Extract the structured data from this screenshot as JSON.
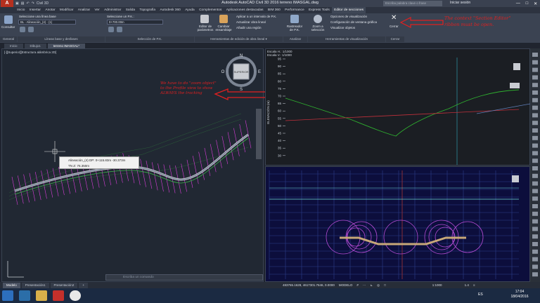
{
  "window": {
    "app_logo": "A",
    "title": "Autodesk AutoCAD Civil 3D 2016   terreno IMASGAL.dwg",
    "qat_label": "Civil 3D",
    "search_placeholder": "Escriba palabra clave o frase",
    "user": "Iniciar sesión",
    "minimize": "—",
    "maximize": "□",
    "close": "✕"
  },
  "menu_tabs": [
    "Inicio",
    "Insertar",
    "Anotar",
    "Modificar",
    "Analizar",
    "Ver",
    "Administrar",
    "Salida",
    "Topografía",
    "Autodesk 360",
    "Ayuda",
    "Complementos",
    "Aplicaciones destacadas",
    "BIM 360",
    "Performance",
    "Express Tools",
    "Editor de secciones"
  ],
  "ribbon": {
    "consultar": "Consultar",
    "select_base_line": "Seleccione una línea base",
    "alignment_select": "BL - Alineación_(4) - (1)",
    "select_pk": "Seleccione un P.K.:",
    "pk_value": "0+700.00m",
    "editor_parametros": "Editor de parámetros",
    "cambiar_ensamblaje": "Cambiar ensamblaje",
    "aplicar_intervalo": "Aplicar a un intervalo de P.K.",
    "actualizar_obra": "Actualizar obra lineal",
    "anadir_region": "Añadir una región",
    "rastreador": "Rastreador de P.K.",
    "zoom_seleccion": "Zoom a selección",
    "opciones_visualizacion": "Opciones de visualización",
    "configuracion_ventana": "Configuración de ventana gráfica",
    "visualizar_objetos": "Visualizar objetos",
    "cerrar": "Cerrar",
    "panel_general": "General",
    "panel_lineas_base": "Líneas base y desfases",
    "panel_seleccion_pk": "Selección de P.K.",
    "panel_herramientas_edicion": "Herramientas de edición de obra lineal ▾",
    "panel_analizar": "Analizar",
    "panel_visualizacion": "Herramientas de visualización",
    "panel_cerrar": "Cerrar"
  },
  "annotation_top": "The context \"Section Editor\" ribbon must be open.",
  "annotation_zoom": "We have to do \"zoom object\" to the Profile view to show ALWAYS the tracking",
  "file_tabs": [
    "Inicio",
    "Dibujo1",
    "terreno IMASGAL*"
  ],
  "viewport_left": {
    "label": "[-][Superior][Estructura alámbrica 2D]",
    "compass_n": "N",
    "compass_s": "S",
    "compass_e": "E",
    "compass_w": "O",
    "viewcube_label": "SUPERIOR"
  },
  "tooltip": {
    "row1": "Alineación_(4)   DP:   0+115.83m      -30.373m",
    "row2": "TN              Z:    76.350m"
  },
  "profile": {
    "scale_h": "Escala H.: 1/1000",
    "scale_v": "Escala V.: 1/1000",
    "ylabel": "ELEVACIÓN (m)",
    "y_ticks": [
      "95",
      "90",
      "85",
      "80",
      "75",
      "70",
      "65",
      "60",
      "55",
      "50",
      "45",
      "40",
      "35",
      "30"
    ]
  },
  "command_placeholder": "Escriba un comando",
  "layout_tabs": [
    "Modelo",
    "Presentación1",
    "Presentación2",
    "+"
  ],
  "status": {
    "coords": "483765.1628, 4617301.7646, 0.0000",
    "mode": "MODELO",
    "scale": "1:1000",
    "zoom": "1.4"
  },
  "taskbar": {
    "lang": "ES",
    "time": "17:04",
    "date": "18/04/2016"
  },
  "colors": {
    "annotation": "#e02020",
    "profile_ground": "#2fb12f",
    "profile_grade": "#c0303b",
    "section_bg": "#0c0e3c",
    "assembly": "#c8a878"
  }
}
